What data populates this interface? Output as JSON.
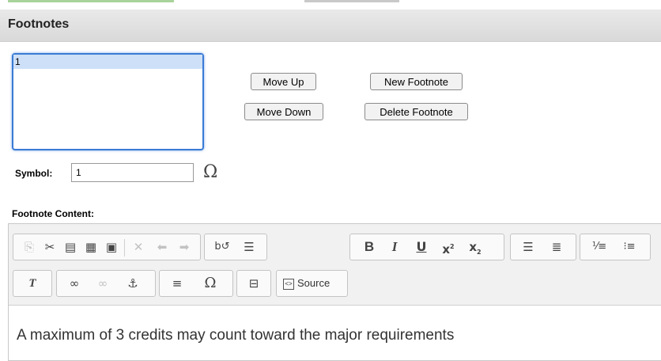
{
  "dialog": {
    "title": "Footnotes"
  },
  "footnote_list": {
    "items": [
      "1"
    ]
  },
  "buttons": {
    "move_up": "Move Up",
    "move_down": "Move Down",
    "new_footnote": "New Footnote",
    "delete_footnote": "Delete Footnote"
  },
  "symbol": {
    "label": "Symbol:",
    "value": "1",
    "special_char_icon": "Ω"
  },
  "footnote_content": {
    "label": "Footnote Content:",
    "text": "A maximum of 3 credits may count toward the major requirements"
  },
  "toolbar": {
    "source_label": "Source",
    "icons": [
      "copy-format-icon",
      "cut-icon",
      "paste-icon",
      "paste-text-icon",
      "paste-word-icon",
      "remove-icon",
      "undo-icon",
      "redo-icon",
      "find-replace-icon",
      "spellcheck-icon",
      "bold-icon",
      "italic-icon",
      "underline-icon",
      "superscript-icon",
      "subscript-icon",
      "align-left-icon",
      "justify-icon",
      "numbered-list-icon",
      "bulleted-list-icon",
      "remove-format-icon",
      "link-icon",
      "unlink-icon",
      "anchor-icon",
      "horizontal-line-icon",
      "special-char-icon",
      "template-icon",
      "source-icon"
    ]
  },
  "colors": {
    "selection": "#cde0f7",
    "focus_border": "#3a7bd5",
    "titlebar": "#dedede"
  }
}
